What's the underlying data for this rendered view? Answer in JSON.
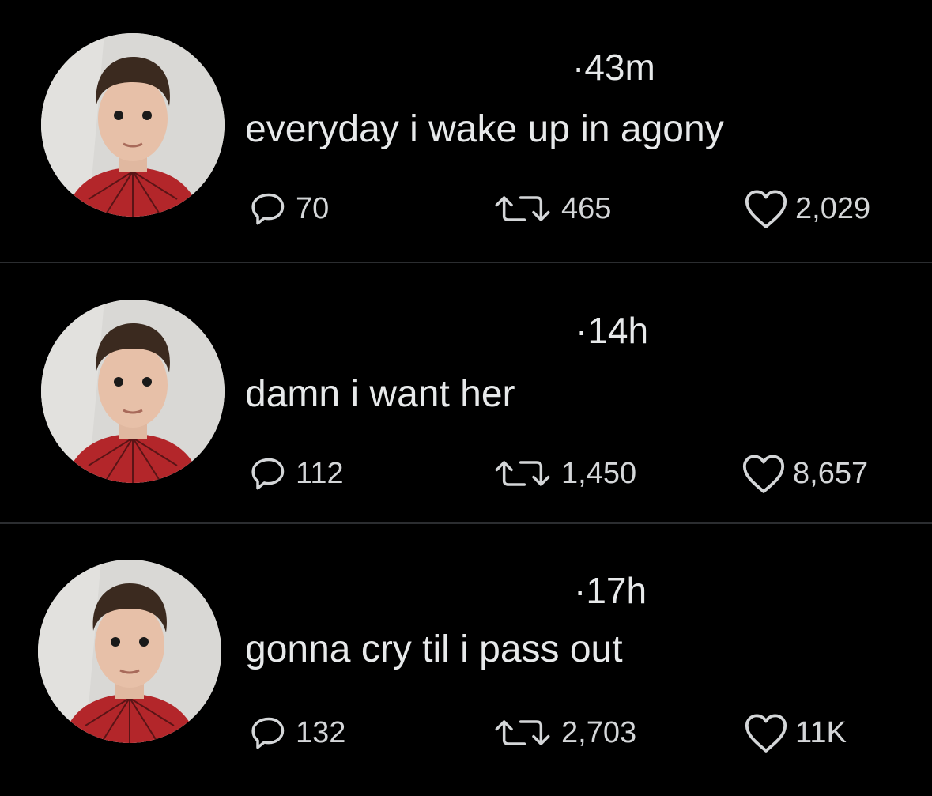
{
  "tweets": [
    {
      "time": "·43m",
      "text": "everyday i wake up in agony",
      "replies": "70",
      "retweets": "465",
      "likes": "2,029",
      "avatar_icon": "profile-photo"
    },
    {
      "time": "·14h",
      "text": "damn i want her",
      "replies": "112",
      "retweets": "1,450",
      "likes": "8,657",
      "avatar_icon": "profile-photo"
    },
    {
      "time": "·17h",
      "text": "gonna cry til i pass out",
      "replies": "132",
      "retweets": "2,703",
      "likes": "11K",
      "avatar_icon": "profile-photo"
    }
  ],
  "colors": {
    "background": "#000000",
    "text": "#e7e9ea",
    "icon": "#d4d6d8",
    "divider": "#2b2d30",
    "shirt": "#b3262a"
  },
  "icons": {
    "reply": "reply-icon",
    "retweet": "retweet-icon",
    "like": "heart-icon"
  }
}
